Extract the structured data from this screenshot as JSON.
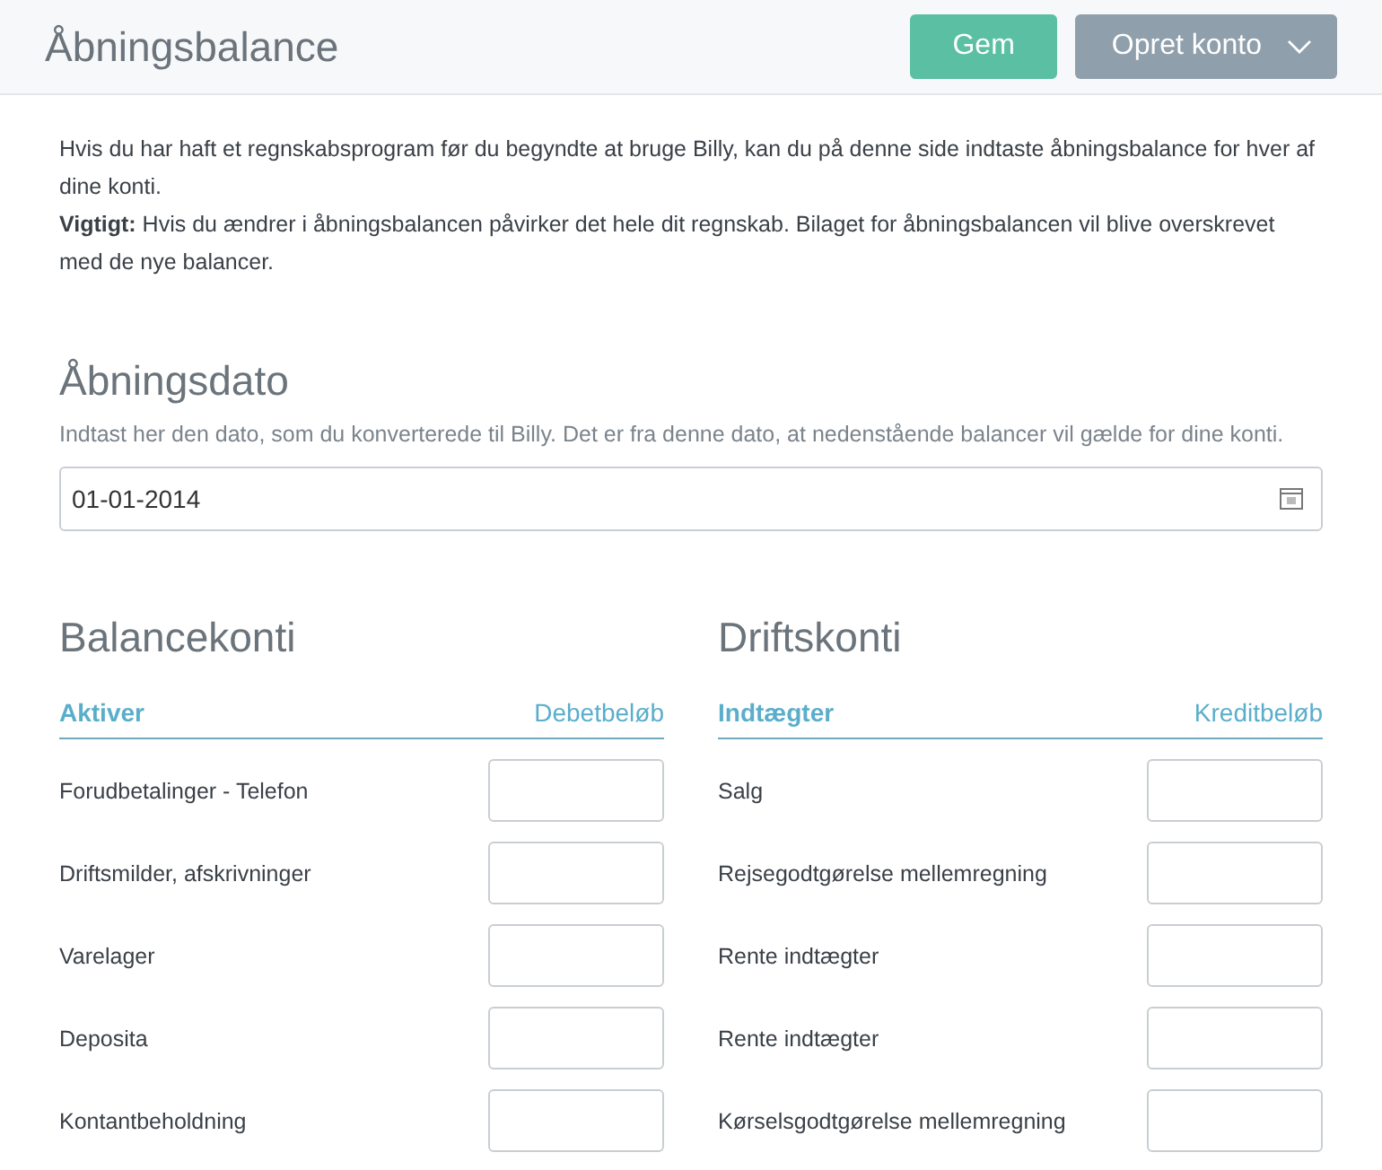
{
  "header": {
    "title": "Åbningsbalance",
    "buttons": [
      {
        "label": "Gem",
        "kind": "primary"
      },
      {
        "label": "Opret konto",
        "kind": "dropdown"
      }
    ]
  },
  "intro": [
    "Hvis du har haft et regnskabsprogram før du begyndte at bruge Billy, kan du på denne side indtaste åbningsbalance for hver af dine konti.",
    "**Vigtigt:** Hvis du ændrer i åbningsbalancen påvirker det hele dit regnskab. Bilaget for åbningsbalancen vil blive overskrevet med de nye balancer."
  ],
  "opening_date": {
    "title": "Åbningsdato",
    "hint": "Indtast her den dato, som du konverterede til Billy. Det er fra denne dato, at nedenstående balancer vil gælde for dine konti.",
    "value": "01-01-2014"
  },
  "sections": [
    {
      "title": "Balancekonti",
      "group": "Aktiver",
      "amount_label": "Debetbeløb",
      "accounts": [
        "Forudbetalinger - Telefon",
        "Driftsmilder, afskrivninger",
        "Varelager",
        "Deposita",
        "Kontantbeholdning"
      ]
    },
    {
      "title": "Driftskonti",
      "group": "Indtægter",
      "amount_label": "Kreditbeløb",
      "accounts": [
        "Salg",
        "Rejsegodtgørelse mellemregning",
        "Rente indtægter",
        "Rente indtægter",
        "Kørselsgodtgørelse mellemregning"
      ]
    }
  ]
}
